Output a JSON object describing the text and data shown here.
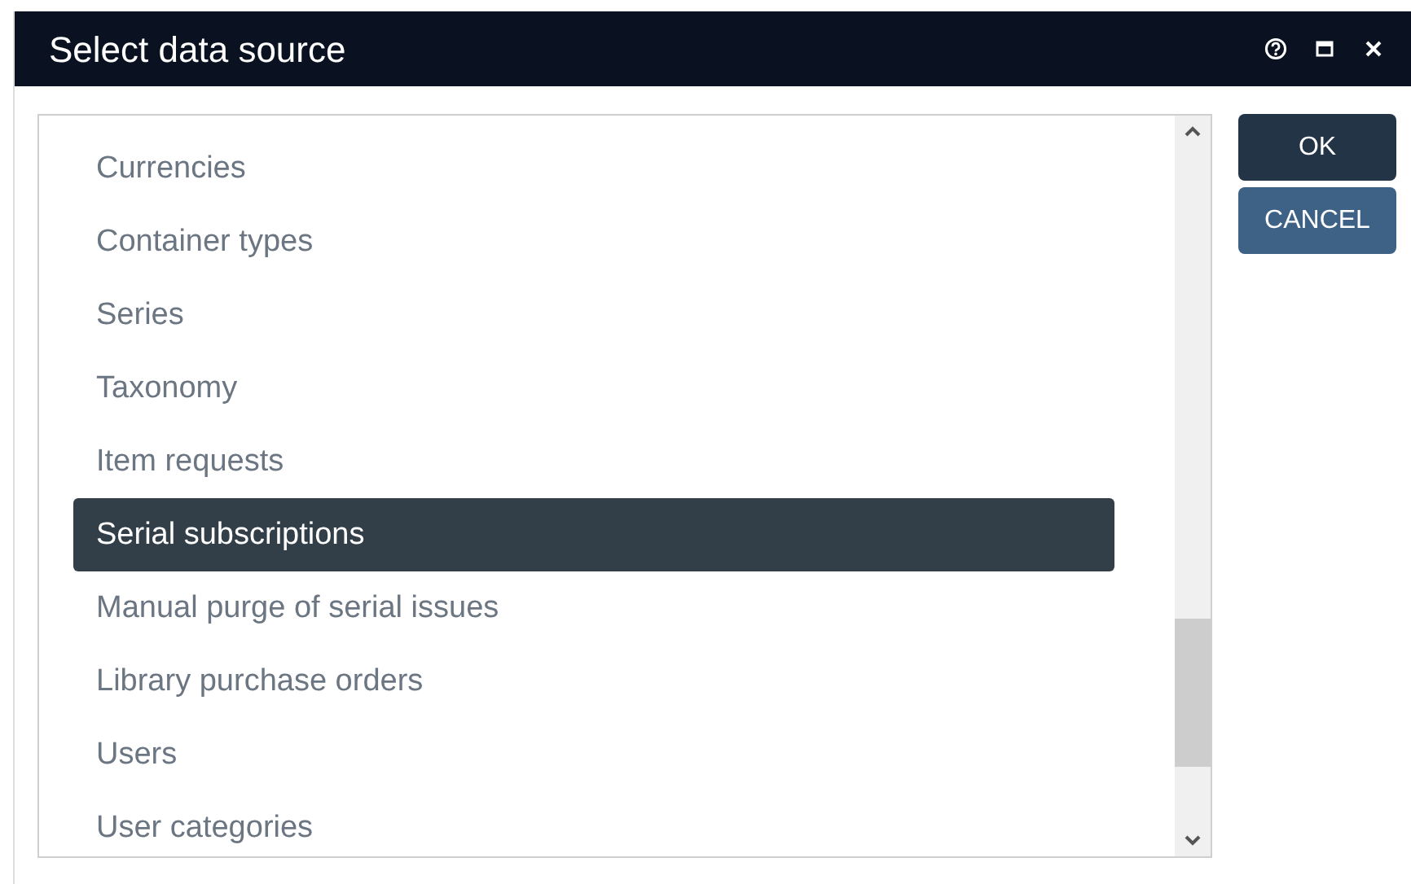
{
  "window": {
    "title": "Select data source"
  },
  "items": [
    {
      "label": "Currencies",
      "selected": false
    },
    {
      "label": "Container types",
      "selected": false
    },
    {
      "label": "Series",
      "selected": false
    },
    {
      "label": "Taxonomy",
      "selected": false
    },
    {
      "label": "Item requests",
      "selected": false
    },
    {
      "label": "Serial subscriptions",
      "selected": true
    },
    {
      "label": "Manual purge of serial issues",
      "selected": false
    },
    {
      "label": "Library purchase orders",
      "selected": false
    },
    {
      "label": "Users",
      "selected": false
    },
    {
      "label": "User categories",
      "selected": false
    }
  ],
  "buttons": [
    {
      "label": "OK",
      "kind": "primary"
    },
    {
      "label": "CANCEL",
      "kind": "secondary"
    }
  ]
}
